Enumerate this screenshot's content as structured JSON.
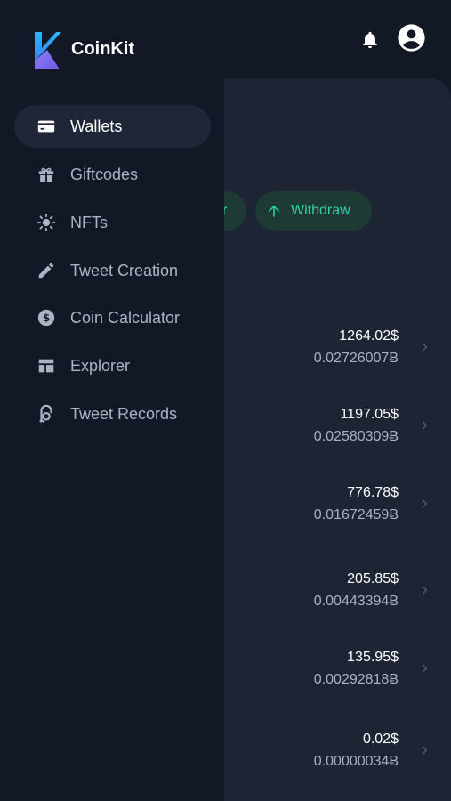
{
  "app": {
    "name": "CoinKit"
  },
  "colors": {
    "accent": "#2bd4a8",
    "background": "#121826",
    "panel": "#1d2434",
    "logo_top": "#29b6f6",
    "logo_bottom": "#7c6cf0"
  },
  "header": {
    "bell_icon": "bell-icon",
    "avatar_icon": "account-circle-icon"
  },
  "actions": {
    "transfer_partial": "r",
    "withdraw_label": "Withdraw"
  },
  "wallets": [
    {
      "usd": "1264.02$",
      "btc": "0.02726007Ƀ"
    },
    {
      "usd": "1197.05$",
      "btc": "0.02580309Ƀ"
    },
    {
      "usd": "776.78$",
      "btc": "0.01672459Ƀ"
    },
    {
      "usd": "205.85$",
      "btc": "0.00443394Ƀ"
    },
    {
      "usd": "135.95$",
      "btc": "0.00292818Ƀ"
    },
    {
      "usd": "0.02$",
      "btc": "0.00000034Ƀ"
    }
  ],
  "nav": [
    {
      "label": "Wallets",
      "icon": "wallet-card-icon",
      "active": true
    },
    {
      "label": "Giftcodes",
      "icon": "gift-icon",
      "active": false
    },
    {
      "label": "NFTs",
      "icon": "sun-icon",
      "active": false
    },
    {
      "label": "Tweet Creation",
      "icon": "pencil-icon",
      "active": false
    },
    {
      "label": "Coin Calculator",
      "icon": "dollar-coin-icon",
      "active": false
    },
    {
      "label": "Explorer",
      "icon": "dashboard-icon",
      "active": false
    },
    {
      "label": "Tweet Records",
      "icon": "records-icon",
      "active": false
    }
  ]
}
